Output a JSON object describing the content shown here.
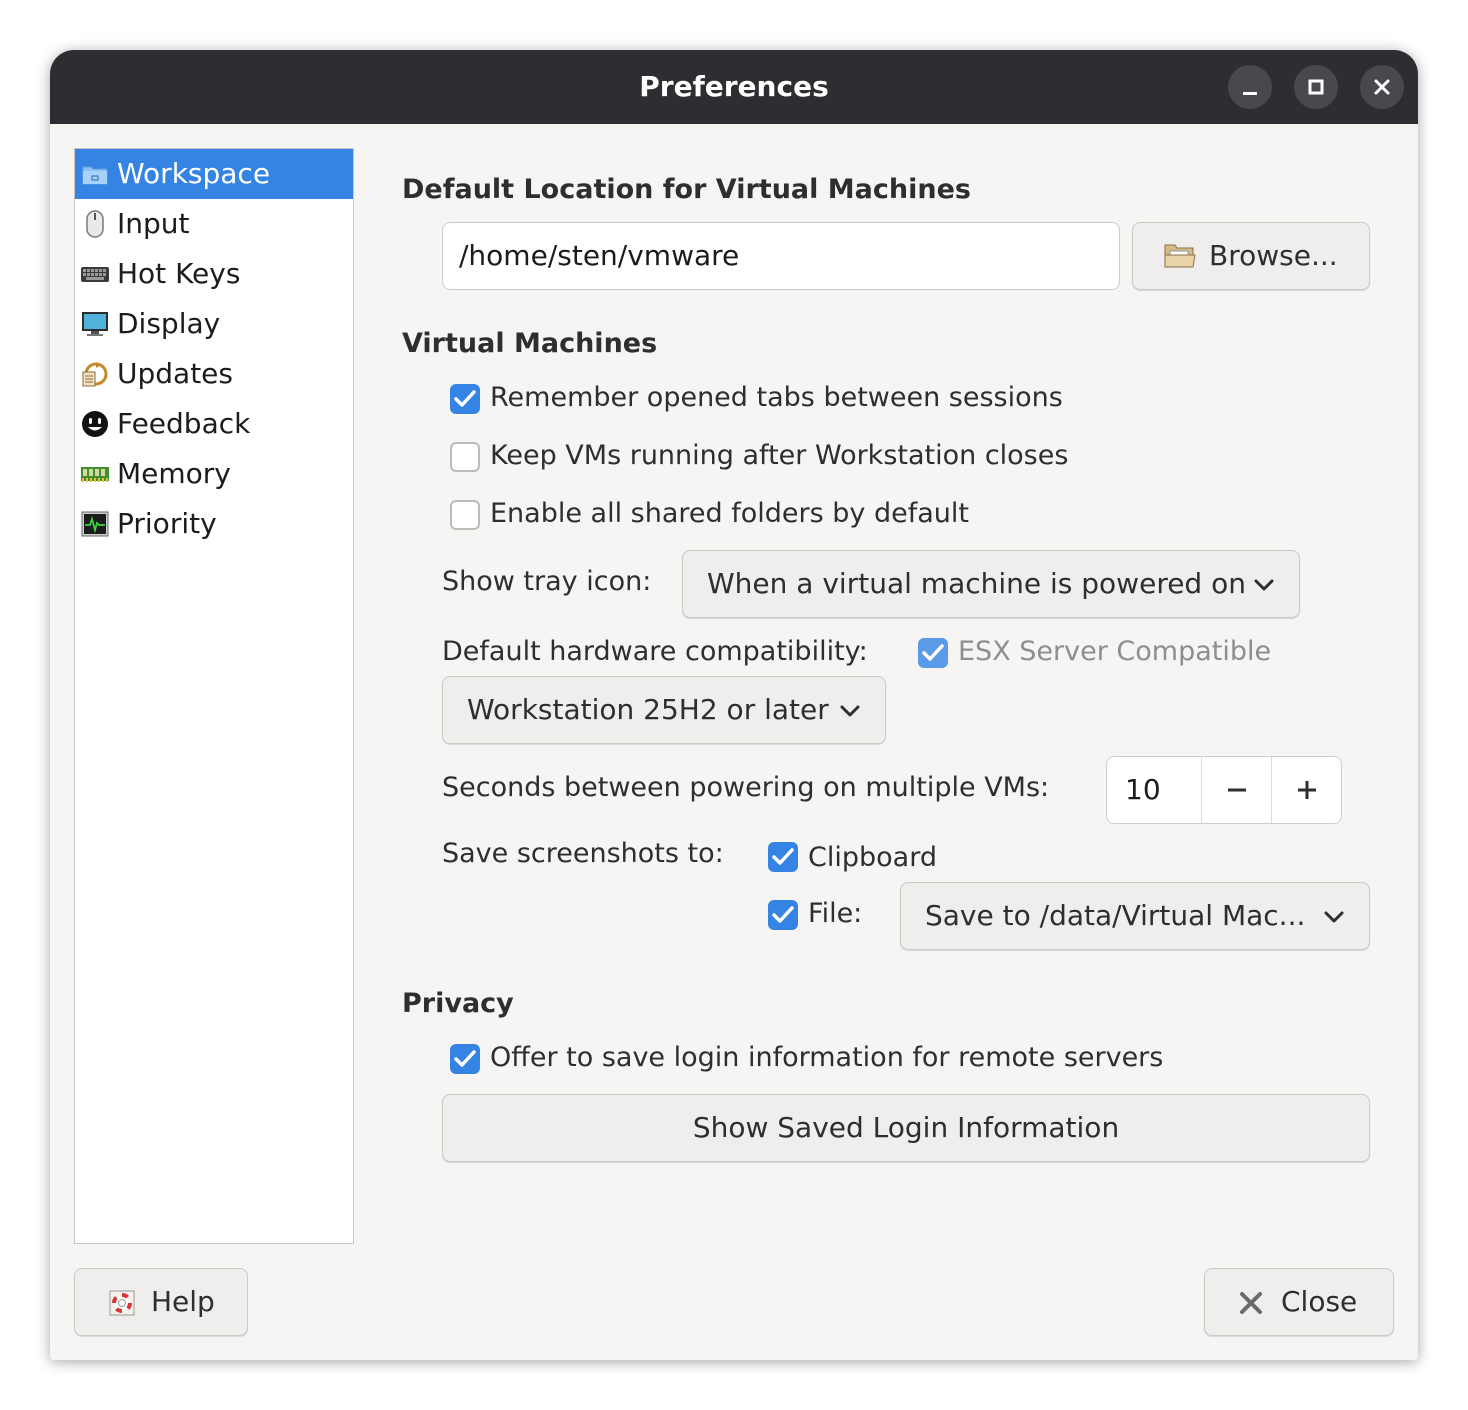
{
  "window": {
    "title": "Preferences"
  },
  "sidebar": {
    "items": [
      {
        "label": "Workspace",
        "icon": "folder-icon",
        "selected": true
      },
      {
        "label": "Input",
        "icon": "mouse-icon",
        "selected": false
      },
      {
        "label": "Hot Keys",
        "icon": "keyboard-icon",
        "selected": false
      },
      {
        "label": "Display",
        "icon": "monitor-icon",
        "selected": false
      },
      {
        "label": "Updates",
        "icon": "updates-icon",
        "selected": false
      },
      {
        "label": "Feedback",
        "icon": "smiley-icon",
        "selected": false
      },
      {
        "label": "Memory",
        "icon": "memory-chip-icon",
        "selected": false
      },
      {
        "label": "Priority",
        "icon": "activity-monitor-icon",
        "selected": false
      }
    ]
  },
  "location": {
    "heading": "Default Location for Virtual Machines",
    "path": "/home/sten/vmware",
    "browse_label": "Browse..."
  },
  "vms": {
    "heading": "Virtual Machines",
    "remember_tabs": {
      "label": "Remember opened tabs between sessions",
      "checked": true
    },
    "keep_running": {
      "label": "Keep VMs running after Workstation closes",
      "checked": false
    },
    "shared_folders": {
      "label": "Enable all shared folders by default",
      "checked": false
    },
    "tray_label": "Show tray icon:",
    "tray_value": "When a virtual machine is powered on",
    "hw_label": "Default hardware compatibility:",
    "esx": {
      "label": "ESX Server Compatible",
      "checked": true,
      "enabled": false
    },
    "hw_value": "Workstation 25H2 or later",
    "seconds_label": "Seconds between powering on multiple VMs:",
    "seconds_value": "10",
    "screenshots_label": "Save screenshots to:",
    "clipboard": {
      "label": "Clipboard",
      "checked": true
    },
    "file": {
      "label": "File:",
      "checked": true
    },
    "file_value": "Save to /data/Virtual Mac..."
  },
  "privacy": {
    "heading": "Privacy",
    "offer_login": {
      "label": "Offer to save login information for remote servers",
      "checked": true
    },
    "show_saved_label": "Show Saved Login Information"
  },
  "footer": {
    "help_label": "Help",
    "close_label": "Close"
  },
  "colors": {
    "accent": "#3584e4",
    "titlebar": "#2e2d31",
    "background": "#f6f5f4"
  }
}
